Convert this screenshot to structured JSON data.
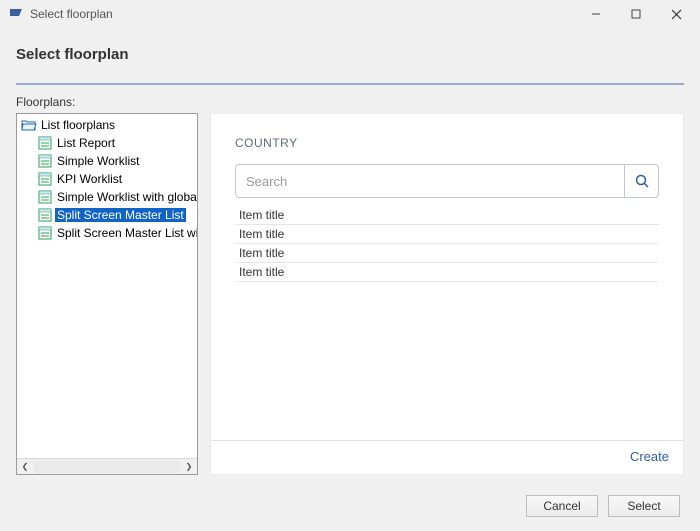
{
  "window": {
    "icon": "floorplan-app-icon",
    "title": "Select floorplan"
  },
  "header": {
    "title": "Select floorplan"
  },
  "sidebar": {
    "section_label": "Floorplans:",
    "root": {
      "label": "List floorplans",
      "children": [
        {
          "label": "List Report"
        },
        {
          "label": "Simple Worklist"
        },
        {
          "label": "KPI Worklist"
        },
        {
          "label": "Simple Worklist with global action"
        },
        {
          "label": "Split Screen Master List",
          "selected": true
        },
        {
          "label": "Split Screen Master List with amou"
        }
      ]
    }
  },
  "preview": {
    "title": "COUNTRY",
    "search": {
      "placeholder": "Search"
    },
    "items": [
      {
        "title": "Item title"
      },
      {
        "title": "Item title"
      },
      {
        "title": "Item title"
      },
      {
        "title": "Item title"
      }
    ],
    "create_label": "Create"
  },
  "footer": {
    "cancel_label": "Cancel",
    "select_label": "Select"
  }
}
